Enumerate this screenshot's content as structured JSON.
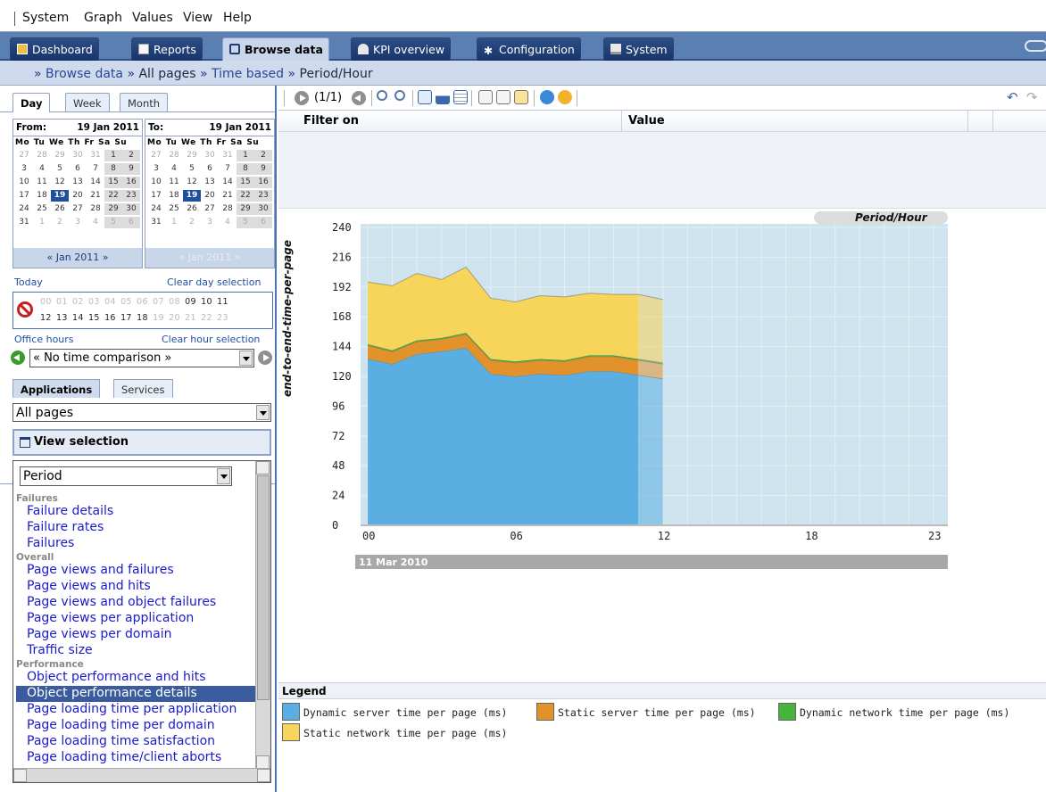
{
  "menu": [
    "System",
    "Graph",
    "Values",
    "View",
    "Help"
  ],
  "tabs": [
    {
      "label": "Dashboard",
      "icon": "dashboard-icon"
    },
    {
      "label": "Reports",
      "icon": "reports-icon"
    },
    {
      "label": "Browse data",
      "icon": "cube-icon",
      "active": true
    },
    {
      "label": "KPI overview",
      "icon": "gauge-icon"
    },
    {
      "label": "Configuration",
      "icon": "gear-icon"
    },
    {
      "label": "System",
      "icon": "monitor-icon"
    }
  ],
  "breadcrumb": {
    "sep": "»",
    "items": [
      "Browse data",
      "All pages",
      "Time based",
      "Period/Hour"
    ]
  },
  "date_tabs": [
    "Day",
    "Week",
    "Month"
  ],
  "cal_from": {
    "label": "From:",
    "date": "19 Jan 2011",
    "nav": "Jan 2011"
  },
  "cal_to": {
    "label": "To:",
    "date": "19 Jan 2011",
    "nav": "Jan 2011"
  },
  "dow": "Mo Tu We Th Fr Sa Su",
  "today": "Today",
  "clear_day": "Clear day selection",
  "hours_row1": [
    "00",
    "01",
    "02",
    "03",
    "04",
    "05",
    "06",
    "07",
    "08",
    "09",
    "10",
    "11"
  ],
  "hours_row2": [
    "12",
    "13",
    "14",
    "15",
    "16",
    "17",
    "18",
    "19",
    "20",
    "21",
    "22",
    "23"
  ],
  "office_hours": "Office hours",
  "clear_hour": "Clear hour selection",
  "time_comparison": "« No time comparison »",
  "app_tabs": [
    "Applications",
    "Services"
  ],
  "pages_select": "All pages",
  "view_selection": "View selection",
  "period_select": "Period",
  "list": [
    {
      "group": "Failures",
      "items": [
        "Failure details",
        "Failure rates",
        "Failures"
      ]
    },
    {
      "group": "Overall",
      "items": [
        "Page views and failures",
        "Page views and hits",
        "Page views and object failures",
        "Page views per application",
        "Page views per domain",
        "Traffic size"
      ]
    },
    {
      "group": "Performance",
      "items": [
        "Object performance and hits",
        "Object performance details",
        "Page loading time per application",
        "Page loading time per domain",
        "Page loading time satisfaction",
        "Page loading time/client aborts"
      ]
    }
  ],
  "selected_item": "Object performance details",
  "toolbar": {
    "page": "(1/1)"
  },
  "filter": {
    "col1": "Filter on",
    "col2": "Value"
  },
  "legend_title": "Legend",
  "colors": {
    "dynamic_server": "#5aaee2",
    "static_server": "#e2922a",
    "dynamic_network": "#46b43a",
    "static_network": "#f7d45a",
    "plot_bg": "#cfe3ee"
  },
  "chart_data": {
    "type": "area",
    "stacked": true,
    "title": "Period/Hour",
    "ylabel": "end-to-end-time-per-page",
    "xlabel": "11 Mar 2010",
    "x": [
      0,
      1,
      2,
      3,
      4,
      5,
      6,
      7,
      8,
      9,
      10,
      11,
      12
    ],
    "xticks": [
      "00",
      "06",
      "12",
      "18",
      "23"
    ],
    "xlim": [
      0,
      23
    ],
    "ylim": [
      0,
      240
    ],
    "yticks": [
      0,
      24,
      48,
      72,
      96,
      120,
      144,
      168,
      192,
      216,
      240
    ],
    "series": [
      {
        "name": "Dynamic server time per page (ms)",
        "values": [
          134,
          130,
          138,
          140,
          143,
          122,
          120,
          122,
          121,
          124,
          124,
          121,
          118
        ]
      },
      {
        "name": "Static server time per page (ms)",
        "values": [
          11,
          10,
          10,
          10,
          11,
          11,
          11,
          11,
          11,
          12,
          12,
          12,
          12
        ]
      },
      {
        "name": "Dynamic network time per page (ms)",
        "values": [
          1,
          1,
          1,
          1,
          1,
          1,
          1,
          1,
          1,
          1,
          1,
          1,
          1
        ]
      },
      {
        "name": "Static network time per page (ms)",
        "values": [
          50,
          52,
          54,
          47,
          53,
          49,
          48,
          51,
          51,
          50,
          49,
          52,
          51
        ]
      }
    ],
    "current_hour": 11,
    "legend": "bottom"
  }
}
